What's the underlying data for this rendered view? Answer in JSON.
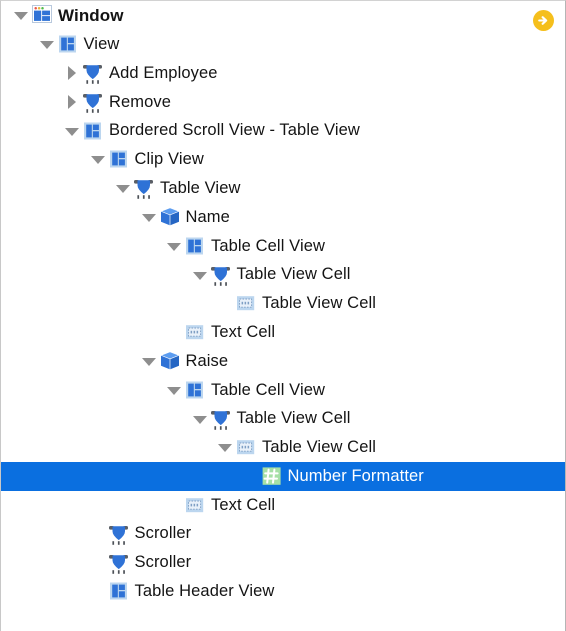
{
  "panel": {
    "title": "Interface Builder Outline View",
    "accent_selected_bg": "#0a6fe0",
    "accent_selected_text": "#ffffff",
    "jump_button_color": "#f5bf1c"
  },
  "jump_button": {
    "name": "jump-to-next-issue-button",
    "icon": "arrow-right-circle-icon"
  },
  "rows": [
    {
      "label": "Window",
      "depth": 0,
      "twisty": "open",
      "icon": "window-icon",
      "selected": false
    },
    {
      "label": "View",
      "depth": 1,
      "twisty": "open",
      "icon": "view-icon",
      "selected": false
    },
    {
      "label": "Add Employee",
      "depth": 2,
      "twisty": "closed",
      "icon": "control-icon",
      "selected": false
    },
    {
      "label": "Remove",
      "depth": 2,
      "twisty": "closed",
      "icon": "control-icon",
      "selected": false
    },
    {
      "label": "Bordered Scroll View - Table View",
      "depth": 2,
      "twisty": "open",
      "icon": "view-icon",
      "selected": false
    },
    {
      "label": "Clip View",
      "depth": 3,
      "twisty": "open",
      "icon": "view-icon",
      "selected": false
    },
    {
      "label": "Table View",
      "depth": 4,
      "twisty": "open",
      "icon": "control-icon",
      "selected": false
    },
    {
      "label": "Name",
      "depth": 5,
      "twisty": "open",
      "icon": "cube-icon",
      "selected": false
    },
    {
      "label": "Table Cell View",
      "depth": 6,
      "twisty": "open",
      "icon": "view-icon",
      "selected": false
    },
    {
      "label": "Table View Cell",
      "depth": 7,
      "twisty": "open",
      "icon": "control-icon",
      "selected": false
    },
    {
      "label": "Table View Cell",
      "depth": 8,
      "twisty": "none",
      "icon": "text-cell-icon",
      "selected": false
    },
    {
      "label": "Text Cell",
      "depth": 6,
      "twisty": "none",
      "icon": "text-cell-icon",
      "selected": false
    },
    {
      "label": "Raise",
      "depth": 5,
      "twisty": "open",
      "icon": "cube-icon",
      "selected": false
    },
    {
      "label": "Table Cell View",
      "depth": 6,
      "twisty": "open",
      "icon": "view-icon",
      "selected": false
    },
    {
      "label": "Table View Cell",
      "depth": 7,
      "twisty": "open",
      "icon": "control-icon",
      "selected": false
    },
    {
      "label": "Table View Cell",
      "depth": 8,
      "twisty": "open",
      "icon": "text-cell-icon",
      "selected": false
    },
    {
      "label": "Number Formatter",
      "depth": 9,
      "twisty": "none",
      "icon": "number-formatter-icon",
      "selected": true
    },
    {
      "label": "Text Cell",
      "depth": 6,
      "twisty": "none",
      "icon": "text-cell-icon",
      "selected": false
    },
    {
      "label": "Scroller",
      "depth": 3,
      "twisty": "none",
      "icon": "control-icon",
      "selected": false
    },
    {
      "label": "Scroller",
      "depth": 3,
      "twisty": "none",
      "icon": "control-icon",
      "selected": false
    },
    {
      "label": "Table Header View",
      "depth": 3,
      "twisty": "none",
      "icon": "view-icon",
      "selected": false
    }
  ]
}
